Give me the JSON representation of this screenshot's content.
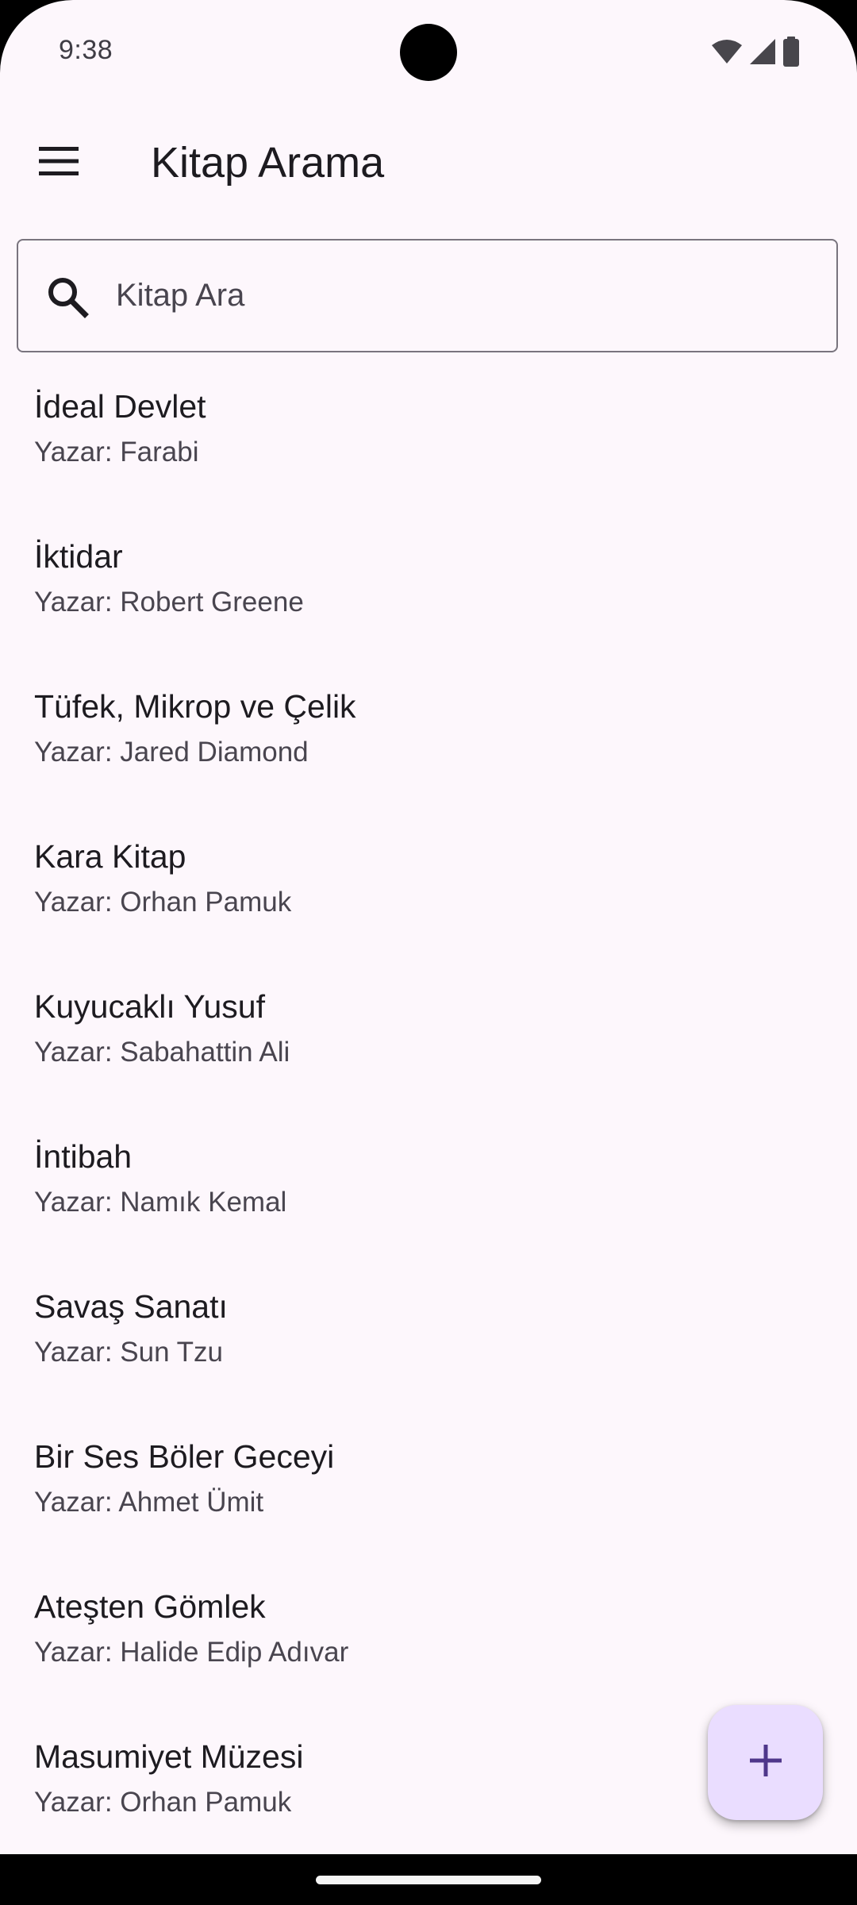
{
  "status_bar": {
    "time": "9:38"
  },
  "app_bar": {
    "title": "Kitap Arama",
    "menu_icon": "menu-icon"
  },
  "search": {
    "placeholder": "Kitap Ara",
    "value": "",
    "icon": "search-icon"
  },
  "books": [
    {
      "title": "İdeal Devlet",
      "author": "Yazar: Farabi"
    },
    {
      "title": "İktidar",
      "author": "Yazar: Robert Greene"
    },
    {
      "title": "Tüfek, Mikrop ve Çelik",
      "author": "Yazar: Jared Diamond"
    },
    {
      "title": "Kara Kitap",
      "author": "Yazar: Orhan Pamuk"
    },
    {
      "title": "Kuyucaklı Yusuf",
      "author": "Yazar: Sabahattin Ali"
    },
    {
      "title": "İntibah",
      "author": "Yazar: Namık Kemal"
    },
    {
      "title": "Savaş Sanatı",
      "author": "Yazar: Sun Tzu"
    },
    {
      "title": "Bir Ses Böler Geceyi",
      "author": "Yazar: Ahmet Ümit"
    },
    {
      "title": "Ateşten Gömlek",
      "author": "Yazar: Halide Edip Adıvar"
    },
    {
      "title": "Masumiyet Müzesi",
      "author": "Yazar: Orhan Pamuk"
    }
  ],
  "fab": {
    "icon": "add-icon"
  },
  "colors": {
    "background": "#fdf7fc",
    "fab": "#eaddff",
    "fab_icon": "#4f378b",
    "text_primary": "#1d1b20",
    "text_secondary": "#49454f",
    "outline": "#79747e"
  }
}
